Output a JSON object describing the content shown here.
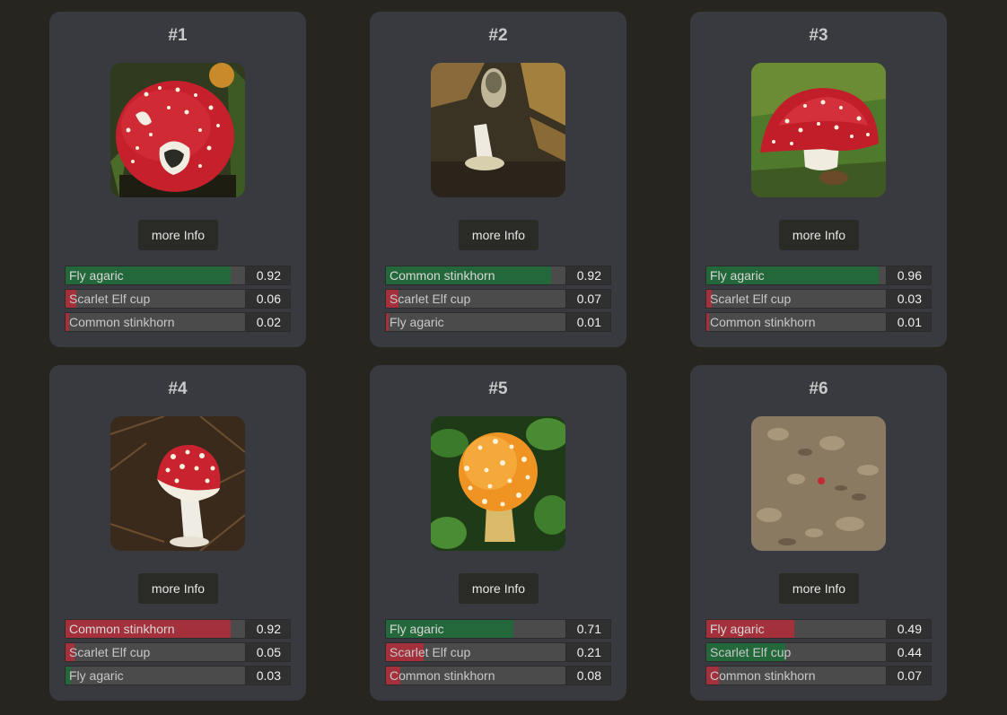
{
  "colors": {
    "match": "#23683a",
    "mismatch": "#a3303a",
    "card": "#393a3f",
    "background": "#262520"
  },
  "button_label": "more Info",
  "cards": [
    {
      "title": "#1",
      "image": "fly-agaric-photo",
      "predictions": [
        {
          "label": "Fly agaric",
          "score": "0.92",
          "value": 0.92,
          "color": "green"
        },
        {
          "label": "Scarlet Elf cup",
          "score": "0.06",
          "value": 0.06,
          "color": "red"
        },
        {
          "label": "Common stinkhorn",
          "score": "0.02",
          "value": 0.02,
          "color": "red"
        }
      ]
    },
    {
      "title": "#2",
      "image": "stinkhorn-photo",
      "predictions": [
        {
          "label": "Common stinkhorn",
          "score": "0.92",
          "value": 0.92,
          "color": "green"
        },
        {
          "label": "Scarlet Elf cup",
          "score": "0.07",
          "value": 0.07,
          "color": "red"
        },
        {
          "label": "Fly agaric",
          "score": "0.01",
          "value": 0.01,
          "color": "red"
        }
      ]
    },
    {
      "title": "#3",
      "image": "fly-agaric-photo",
      "predictions": [
        {
          "label": "Fly agaric",
          "score": "0.96",
          "value": 0.96,
          "color": "green"
        },
        {
          "label": "Scarlet Elf cup",
          "score": "0.03",
          "value": 0.03,
          "color": "red"
        },
        {
          "label": "Common stinkhorn",
          "score": "0.01",
          "value": 0.01,
          "color": "red"
        }
      ]
    },
    {
      "title": "#4",
      "image": "fly-agaric-young-photo",
      "predictions": [
        {
          "label": "Common stinkhorn",
          "score": "0.92",
          "value": 0.92,
          "color": "red"
        },
        {
          "label": "Scarlet Elf cup",
          "score": "0.05",
          "value": 0.05,
          "color": "red"
        },
        {
          "label": "Fly agaric",
          "score": "0.03",
          "value": 0.03,
          "color": "green"
        }
      ]
    },
    {
      "title": "#5",
      "image": "orange-fly-agaric-photo",
      "predictions": [
        {
          "label": "Fly agaric",
          "score": "0.71",
          "value": 0.71,
          "color": "green"
        },
        {
          "label": "Scarlet Elf cup",
          "score": "0.21",
          "value": 0.21,
          "color": "red"
        },
        {
          "label": "Common stinkhorn",
          "score": "0.08",
          "value": 0.08,
          "color": "red"
        }
      ]
    },
    {
      "title": "#6",
      "image": "forest-floor-photo",
      "predictions": [
        {
          "label": "Fly agaric",
          "score": "0.49",
          "value": 0.49,
          "color": "red"
        },
        {
          "label": "Scarlet Elf cup",
          "score": "0.44",
          "value": 0.44,
          "color": "green"
        },
        {
          "label": "Common stinkhorn",
          "score": "0.07",
          "value": 0.07,
          "color": "red"
        }
      ]
    }
  ]
}
